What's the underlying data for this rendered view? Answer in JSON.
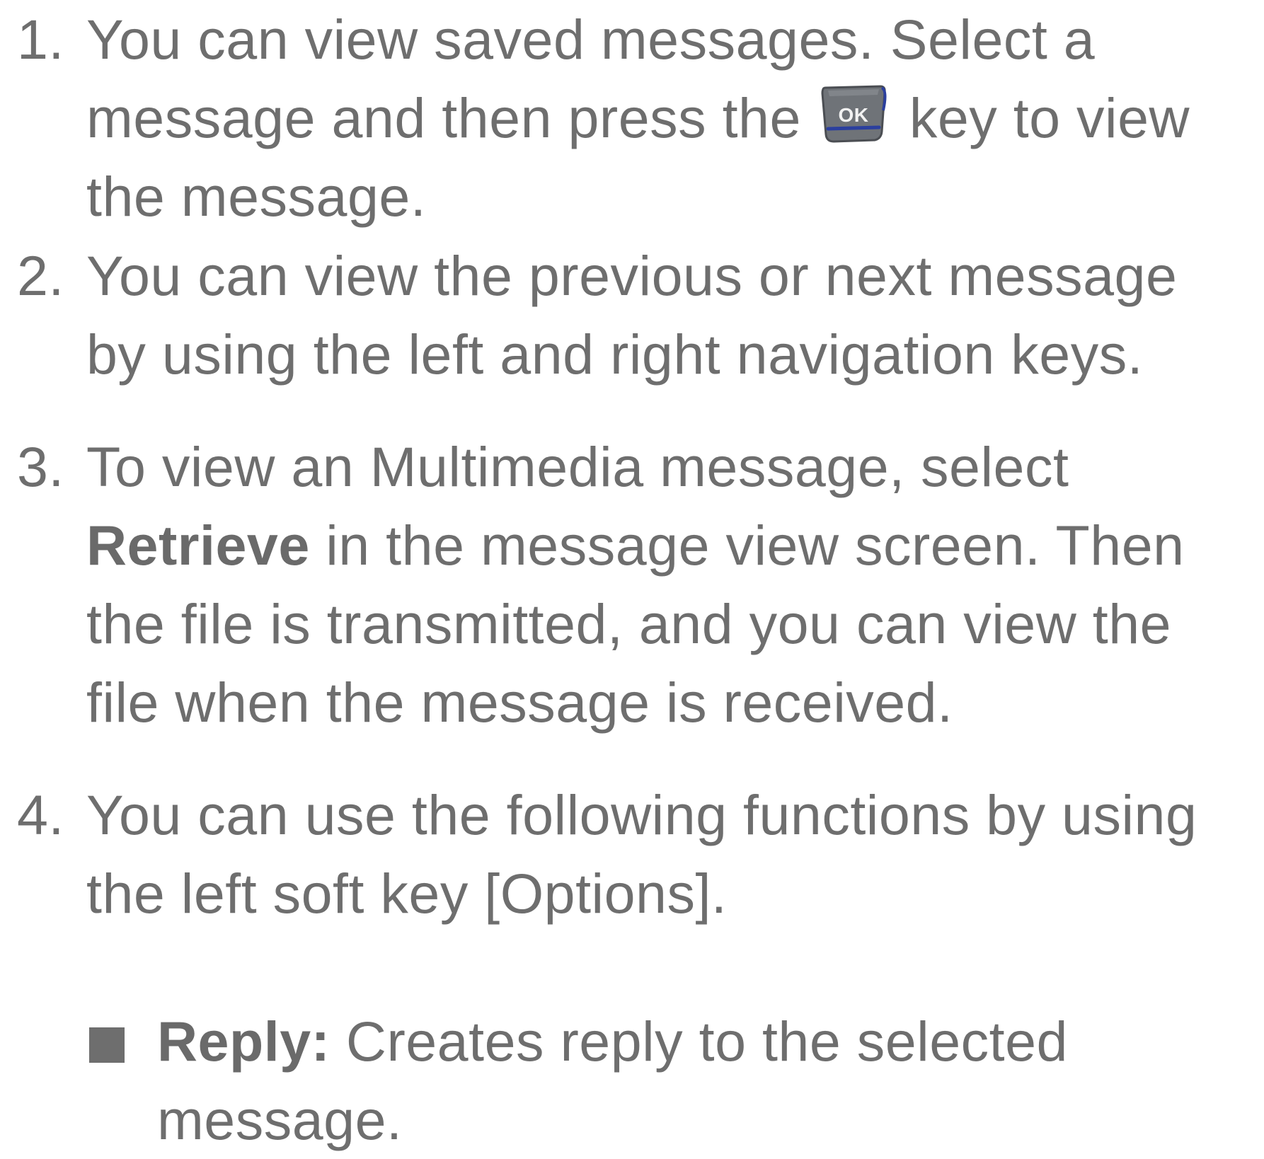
{
  "steps": [
    {
      "number": "1.",
      "line1": "You can view saved messages. Select a",
      "line2_before": "message and then press the",
      "line2_after": "key to view",
      "line3": "the message.",
      "key_icon": "ok-key-icon",
      "key_label": "OK"
    },
    {
      "number": "2.",
      "line1": "You can view the previous or next message",
      "line2": "by using the left and right navigation keys."
    },
    {
      "number": "3.",
      "line1": "To view an Multimedia message, select",
      "line2_bold": "Retrieve",
      "line2_rest": " in the message view screen. Then",
      "line3": "the file is transmitted, and you can view the",
      "line4": "file when the message is received."
    },
    {
      "number": "4.",
      "line1": "You can use the following functions by using",
      "line2": "the left soft key [Options]."
    }
  ],
  "bullets": [
    {
      "icon": "square-bullet-icon",
      "term": "Reply:",
      "line1_rest": " Creates reply to the selected",
      "line2": "message."
    }
  ],
  "colors": {
    "text": "#6e6e6e",
    "key_body": "#6f7378",
    "key_accent": "#2b3f9e"
  }
}
